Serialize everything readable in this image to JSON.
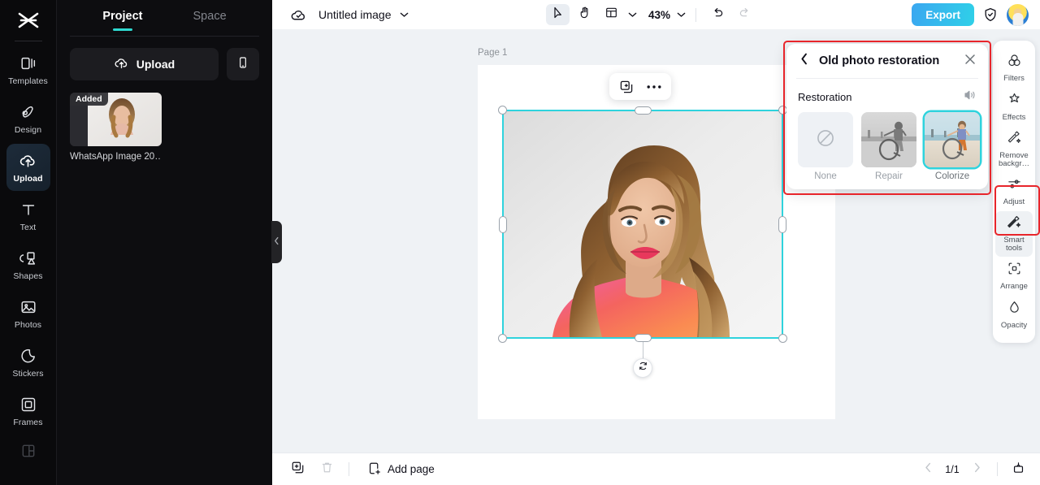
{
  "rail": {
    "logo_icon": "capcut-logo-icon",
    "items": [
      {
        "label": "Templates",
        "icon": "templates-icon",
        "active": false
      },
      {
        "label": "Design",
        "icon": "design-icon",
        "active": false
      },
      {
        "label": "Upload",
        "icon": "upload-cloud-icon",
        "active": true
      },
      {
        "label": "Text",
        "icon": "text-icon",
        "active": false
      },
      {
        "label": "Shapes",
        "icon": "shapes-icon",
        "active": false
      },
      {
        "label": "Photos",
        "icon": "photos-icon",
        "active": false
      },
      {
        "label": "Stickers",
        "icon": "stickers-icon",
        "active": false
      },
      {
        "label": "Frames",
        "icon": "frames-icon",
        "active": false
      }
    ],
    "partial_item_icon": "layout-grid-icon"
  },
  "panel": {
    "tabs": [
      {
        "label": "Project",
        "active": true
      },
      {
        "label": "Space",
        "active": false
      }
    ],
    "upload_label": "Upload",
    "upload_icon": "upload-cloud-icon",
    "phone_icon": "mobile-phone-icon",
    "assets": [
      {
        "badge": "Added",
        "name": "WhatsApp Image 20…"
      }
    ],
    "collapse_icon": "chevron-left-icon"
  },
  "topbar": {
    "cloud_icon": "cloud-saved-icon",
    "doc_title": "Untitled image",
    "doc_caret_icon": "chevron-down-icon",
    "tools": [
      {
        "name": "select-tool",
        "icon": "cursor-arrow-icon",
        "active": true
      },
      {
        "name": "hand-tool",
        "icon": "hand-icon",
        "active": false
      },
      {
        "name": "layout-tool",
        "icon": "page-layout-icon",
        "active": false
      }
    ],
    "layout_caret_icon": "chevron-down-icon",
    "zoom_value": "43%",
    "zoom_caret_icon": "chevron-down-icon",
    "undo_icon": "undo-icon",
    "redo_icon": "redo-icon",
    "export_label": "Export",
    "shield_icon": "shield-check-icon",
    "avatar_name": "user-avatar"
  },
  "canvas": {
    "page_label": "Page 1",
    "float_toolbar": [
      {
        "name": "duplicate-button",
        "icon": "duplicate-icon"
      },
      {
        "name": "more-options-button",
        "icon": "more-horizontal-icon"
      }
    ],
    "rotate_icon": "rotate-icon",
    "selection_color": "#2fd3dd"
  },
  "restoration": {
    "back_icon": "chevron-left-icon",
    "title": "Old photo restoration",
    "close_icon": "close-icon",
    "section_label": "Restoration",
    "compare_icon": "compare-toggle-icon",
    "options": [
      {
        "label": "None",
        "icon": "no-effect-icon",
        "selected": false
      },
      {
        "label": "Repair",
        "icon": "repair-thumbnail",
        "selected": false
      },
      {
        "label": "Colorize",
        "icon": "colorize-thumbnail",
        "selected": true
      }
    ],
    "highlight_color": "#e8252b"
  },
  "rightbar": {
    "items": [
      {
        "label": "Filters",
        "icon": "filters-icon",
        "selected": false
      },
      {
        "label": "Effects",
        "icon": "effects-icon",
        "selected": false
      },
      {
        "label": "Remove\nbackgr…",
        "icon": "remove-background-icon",
        "selected": false
      },
      {
        "label": "Adjust",
        "icon": "adjust-sliders-icon",
        "selected": false
      },
      {
        "label": "Smart\ntools",
        "icon": "smart-tools-icon",
        "selected": true
      },
      {
        "label": "Arrange",
        "icon": "arrange-icon",
        "selected": false
      },
      {
        "label": "Opacity",
        "icon": "opacity-icon",
        "selected": false
      }
    ],
    "highlight_color": "#e8252b"
  },
  "bottombar": {
    "duplicate_page_icon": "duplicate-page-icon",
    "delete_page_icon": "trash-icon",
    "add_page_icon": "add-page-icon",
    "add_page_label": "Add page",
    "prev_icon": "chevron-left-icon",
    "page_indicator": "1/1",
    "next_icon": "chevron-right-icon",
    "expand_icon": "expand-panel-icon"
  }
}
